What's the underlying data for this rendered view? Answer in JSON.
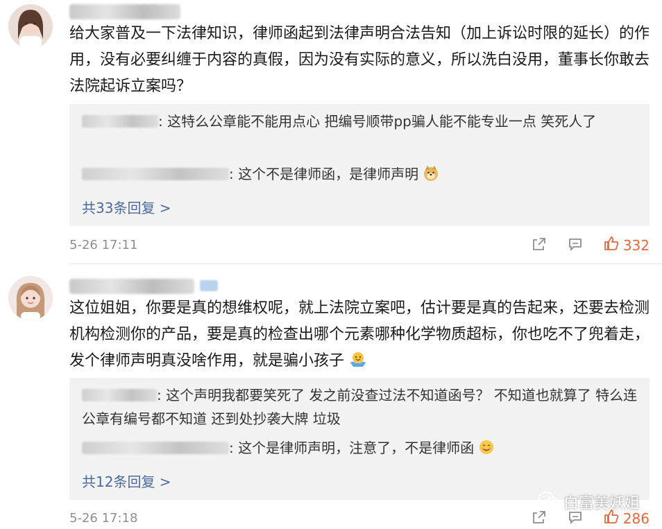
{
  "comments": [
    {
      "text": "给大家普及一下法律知识，律师函起到法律声明合法告知（加上诉讼时限的延长）的作用，没有必要纠缠于内容的真假，因为没有实际的意义，所以洗白没用，董事长你敢去法院起诉立案吗？",
      "replies": [
        {
          "text": ": 这特么公章能不能用点心 把编号顺带pp骗人能不能专业一点 笑死人了"
        },
        {
          "text": ": 这个不是律师函，是律师声明"
        }
      ],
      "more_replies": "共33条回复 >",
      "timestamp": "5-26 17:11",
      "likes": "332"
    },
    {
      "text": "这位姐姐，你要是真的想维权呢，就上法院立案吧，估计要是真的告起来，还要去检测机构检测你的产品，要是真的检查出哪个元素哪种化学物质超标，你也吃不了兜着走，发个律师声明真没啥作用，就是骗小孩子",
      "replies": [
        {
          "text": ": 这个声明我都要笑死了 发之前没查过法不知道函号？ 不知道也就算了 特么连公章有编号都不知道 还到处抄袭大牌 垃圾"
        },
        {
          "text": ": 这个是律师声明，注意了，不是律师函"
        }
      ],
      "more_replies": "共12条回复 >",
      "timestamp": "5-26 17:18",
      "likes": "286"
    }
  ],
  "watermark": "白富美妖姐",
  "colors": {
    "likes": "#e5683a",
    "link": "#4a6a9c",
    "reply_bg": "#f2f2f2",
    "meta": "#8e8e8e"
  },
  "icons": [
    "share-icon",
    "comment-icon",
    "thumbs-up-icon",
    "wechat-icon",
    "doge-emoji",
    "smile-emoji",
    "hug-emoji"
  ]
}
